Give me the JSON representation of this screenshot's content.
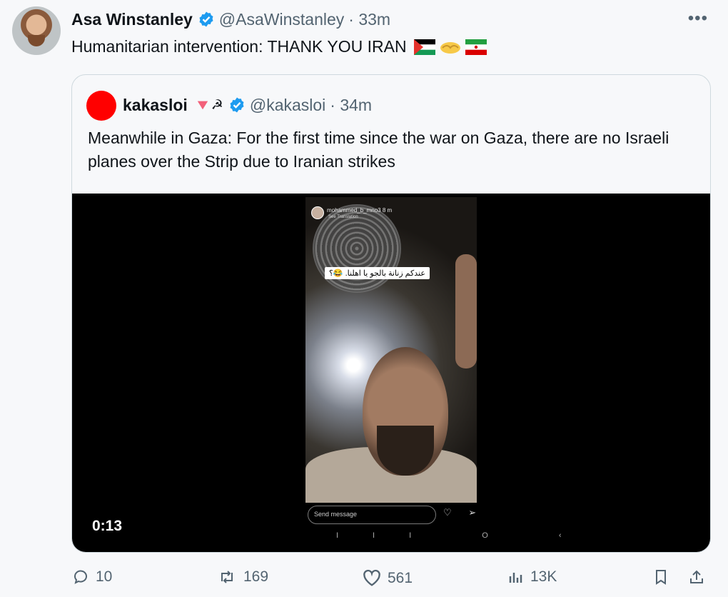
{
  "tweet": {
    "author_name": "Asa Winstanley",
    "author_handle": "@AsaWinstanley",
    "time_ago": "· 33m",
    "text": "Humanitarian intervention: THANK YOU IRAN",
    "more_label": "•••",
    "flag_icons": [
      "palestine-flag-icon",
      "handshake-icon",
      "iran-flag-icon"
    ]
  },
  "quote": {
    "author_name": "kakasloi",
    "author_handle": "@kakasloi",
    "time_ago": "· 34m",
    "text": "Meanwhile in Gaza: For the first time since the war on Gaza, there are no Israeli planes over the Strip due to Iranian strikes",
    "avatar_color": "#ff0000",
    "video": {
      "duration": "0:13",
      "story_user": "mohammed_b_mno3  8 m",
      "story_sub": "See Translation",
      "caption": "عندكم زنانة بالجو يا اهلنا. 😂؟",
      "send_placeholder": "Send message",
      "send_icons": "♡ ➢",
      "nav_buttons": "III O ‹"
    }
  },
  "actions": {
    "replies": "10",
    "reposts": "169",
    "likes": "561",
    "views": "13K"
  },
  "colors": {
    "verified": "#1d9bf0",
    "muted": "#536471"
  }
}
